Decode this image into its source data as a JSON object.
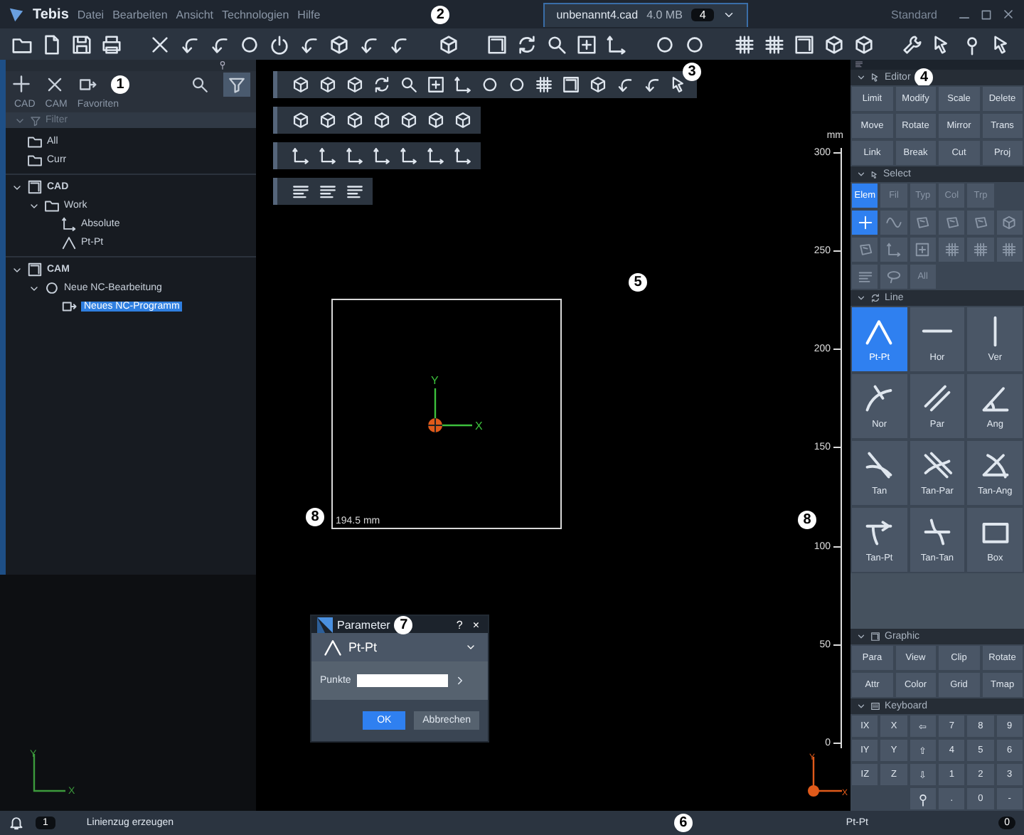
{
  "title_bar": {
    "app_name": "Tebis",
    "menu": [
      "Datei",
      "Bearbeiten",
      "Ansicht",
      "Technologien",
      "Hilfe"
    ],
    "callout": "2",
    "file_tab": {
      "name": "unbenannt4.cad",
      "size": "4.0 MB",
      "count": "4"
    },
    "workspace": "Standard"
  },
  "left_panel": {
    "callout": "1",
    "tabs": [
      {
        "label": "CAD",
        "selected": false
      },
      {
        "label": "CAM",
        "selected": false
      },
      {
        "label": "Favoriten",
        "selected": false
      }
    ],
    "filter": "Filter",
    "tree": [
      {
        "label": "All",
        "kind": "folder",
        "selected": false
      },
      {
        "label": "Curr",
        "kind": "folder",
        "selected": false
      },
      {
        "label": "CAD",
        "kind": "cad",
        "selected": false,
        "expanded": true,
        "children": [
          {
            "label": "Work",
            "kind": "folder",
            "selected": false,
            "expanded": true,
            "children": [
              {
                "label": "Absolute",
                "kind": "axes",
                "selected": false
              },
              {
                "label": "Pt-Pt",
                "kind": "line",
                "selected": false
              }
            ]
          }
        ]
      },
      {
        "label": "CAM",
        "kind": "cam",
        "selected": false,
        "expanded": true,
        "children": [
          {
            "label": "Neue NC-Bearbeitung",
            "kind": "job",
            "selected": false,
            "expanded": true,
            "children": [
              {
                "label": "Neues NC-Programm",
                "kind": "program",
                "selected": true
              }
            ]
          }
        ]
      }
    ]
  },
  "viewport": {
    "toolbar_callout": "3",
    "callout": "5",
    "frame_callout": "8",
    "ruler_callout": "8",
    "frame_size": "194.5 mm",
    "origin_axes": {
      "y": "Y",
      "x": "X"
    },
    "left_axes": {
      "y": "Y",
      "x": "X"
    },
    "right_axes": {
      "y": "Y",
      "x": "X"
    },
    "ruler_unit": "mm",
    "ruler_ticks": [
      "300",
      "250",
      "200",
      "150",
      "100",
      "50",
      "0"
    ],
    "dialog": {
      "title": "Parameter",
      "callout": "7",
      "help": "?",
      "close": "×",
      "function": "Pt-Pt",
      "field_label": "Punkte",
      "buttons": [
        {
          "label": "OK",
          "kind": "primary"
        },
        {
          "label": "Abbrechen",
          "kind": "secondary"
        }
      ]
    }
  },
  "right_panel": {
    "callout": "4",
    "editor": {
      "title": "Editor",
      "buttons": [
        "Limit",
        "Modify",
        "Scale",
        "Delete",
        "Move",
        "Rotate",
        "Mirror",
        "Trans",
        "Link",
        "Break",
        "Cut",
        "Proj"
      ]
    },
    "select": {
      "title": "Select",
      "tabs": [
        {
          "label": "Elem",
          "selected": true
        },
        {
          "label": "Fil",
          "selected": false
        },
        {
          "label": "Typ",
          "selected": false
        },
        {
          "label": "Col",
          "selected": false
        },
        {
          "label": "Trp",
          "selected": false
        }
      ],
      "items": [
        {
          "kind": "add",
          "selected": true
        },
        {
          "kind": "wave",
          "selected": false
        },
        {
          "kind": "face",
          "selected": false
        },
        {
          "kind": "face",
          "selected": false
        },
        {
          "kind": "face",
          "selected": false
        },
        {
          "kind": "cube",
          "selected": false
        },
        {
          "kind": "face",
          "selected": false
        },
        {
          "kind": "axes",
          "selected": false
        },
        {
          "kind": "frame",
          "selected": false
        },
        {
          "kind": "grid",
          "selected": false
        },
        {
          "kind": "grid",
          "selected": false
        },
        {
          "kind": "grid",
          "selected": false
        },
        {
          "kind": "lines",
          "selected": false
        },
        {
          "kind": "lasso",
          "selected": false
        },
        {
          "kind": "text",
          "label": "All",
          "selected": false
        }
      ]
    },
    "line": {
      "title": "Line",
      "tools": [
        {
          "label": "Pt-Pt",
          "selected": true
        },
        {
          "label": "Hor",
          "selected": false
        },
        {
          "label": "Ver",
          "selected": false
        },
        {
          "label": "Nor",
          "selected": false
        },
        {
          "label": "Par",
          "selected": false
        },
        {
          "label": "Ang",
          "selected": false
        },
        {
          "label": "Tan",
          "selected": false
        },
        {
          "label": "Tan-Par",
          "selected": false
        },
        {
          "label": "Tan-Ang",
          "selected": false
        },
        {
          "label": "Tan-Pt",
          "selected": false
        },
        {
          "label": "Tan-Tan",
          "selected": false
        },
        {
          "label": "Box",
          "selected": false
        }
      ]
    },
    "graphic": {
      "title": "Graphic",
      "buttons": [
        "Para",
        "View",
        "Clip",
        "Rotate",
        "Attr",
        "Color",
        "Grid",
        "Tmap"
      ]
    },
    "keyboard": {
      "title": "Keyboard",
      "keys": [
        {
          "kind": "text",
          "label": "IX"
        },
        {
          "kind": "text",
          "label": "X"
        },
        {
          "kind": "text",
          "label": "⇦"
        },
        {
          "kind": "text",
          "label": "7"
        },
        {
          "kind": "text",
          "label": "8"
        },
        {
          "kind": "text",
          "label": "9"
        },
        {
          "kind": "text",
          "label": "IY"
        },
        {
          "kind": "text",
          "label": "Y"
        },
        {
          "kind": "text",
          "label": "⇧"
        },
        {
          "kind": "text",
          "label": "4"
        },
        {
          "kind": "text",
          "label": "5"
        },
        {
          "kind": "text",
          "label": "6"
        },
        {
          "kind": "text",
          "label": "IZ"
        },
        {
          "kind": "text",
          "label": "Z"
        },
        {
          "kind": "text",
          "label": "⇩"
        },
        {
          "kind": "text",
          "label": "1"
        },
        {
          "kind": "text",
          "label": "2"
        },
        {
          "kind": "text",
          "label": "3"
        },
        {
          "kind": "blank"
        },
        {
          "kind": "blank"
        },
        {
          "kind": "pin"
        },
        {
          "kind": "text",
          "label": "."
        },
        {
          "kind": "text",
          "label": "0"
        },
        {
          "kind": "text",
          "label": "-"
        }
      ]
    }
  },
  "status_bar": {
    "count": "1",
    "message": "Linienzug erzeugen",
    "callout": "6",
    "function": "Pt-Pt",
    "badge": "0"
  }
}
